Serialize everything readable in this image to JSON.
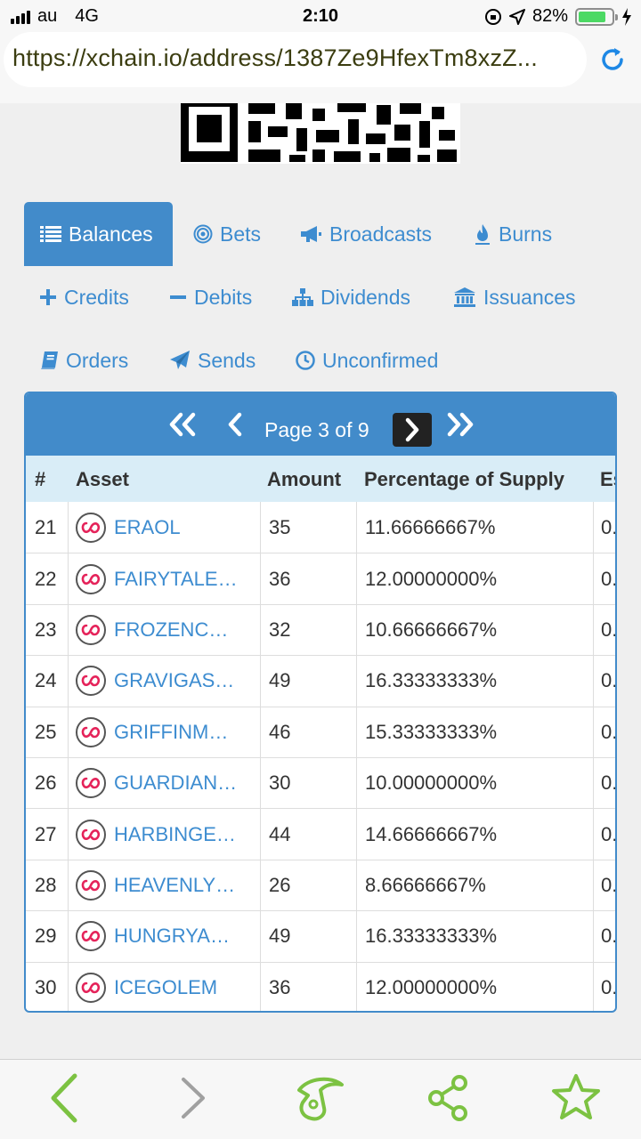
{
  "status": {
    "carrier": "au",
    "network": "4G",
    "time": "2:10",
    "battery": "82%",
    "battery_level": 0.82
  },
  "browser": {
    "url": "https://xchain.io/address/1387Ze9HfexTm8xzZ..."
  },
  "tabs": {
    "balances": "Balances",
    "bets": "Bets",
    "broadcasts": "Broadcasts",
    "burns": "Burns",
    "credits": "Credits",
    "debits": "Debits",
    "dividends": "Dividends",
    "issuances": "Issuances",
    "orders": "Orders",
    "sends": "Sends",
    "unconfirmed": "Unconfirmed"
  },
  "pager": {
    "label": "Page 3 of 9"
  },
  "table": {
    "headers": {
      "num": "#",
      "asset": "Asset",
      "amount": "Amount",
      "pct": "Percentage of Supply",
      "est": "Es"
    },
    "rows": [
      {
        "num": "21",
        "asset": "ERAOL",
        "amount": "35",
        "pct": "11.66666667%",
        "est": "0."
      },
      {
        "num": "22",
        "asset": "FAIRYTALE…",
        "amount": "36",
        "pct": "12.00000000%",
        "est": "0."
      },
      {
        "num": "23",
        "asset": "FROZENC…",
        "amount": "32",
        "pct": "10.66666667%",
        "est": "0."
      },
      {
        "num": "24",
        "asset": "GRAVIGAS…",
        "amount": "49",
        "pct": "16.33333333%",
        "est": "0."
      },
      {
        "num": "25",
        "asset": "GRIFFINM…",
        "amount": "46",
        "pct": "15.33333333%",
        "est": "0."
      },
      {
        "num": "26",
        "asset": "GUARDIAN…",
        "amount": "30",
        "pct": "10.00000000%",
        "est": "0."
      },
      {
        "num": "27",
        "asset": "HARBINGE…",
        "amount": "44",
        "pct": "14.66666667%",
        "est": "0."
      },
      {
        "num": "28",
        "asset": "HEAVENLY…",
        "amount": "26",
        "pct": "8.66666667%",
        "est": "0."
      },
      {
        "num": "29",
        "asset": "HUNGRYA…",
        "amount": "49",
        "pct": "16.33333333%",
        "est": "0."
      },
      {
        "num": "30",
        "asset": "ICEGOLEM",
        "amount": "36",
        "pct": "12.00000000%",
        "est": "0."
      }
    ]
  },
  "colors": {
    "accent": "#428bca",
    "link": "#3d8cd0",
    "toolbar_green": "#7cc242",
    "table_header": "#d9edf7"
  },
  "icons": {
    "toolbar": [
      "back-arrow-icon",
      "forward-arrow-icon",
      "dolphin-icon",
      "share-icon",
      "star-icon"
    ]
  }
}
